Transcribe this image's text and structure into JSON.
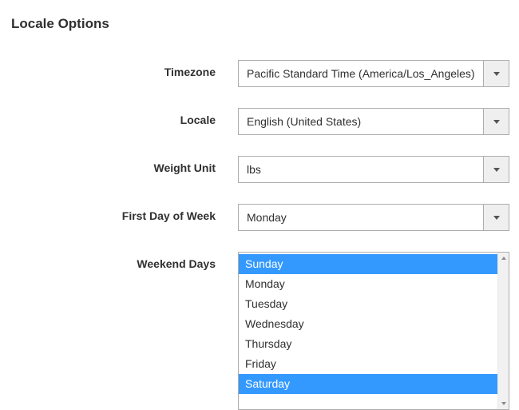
{
  "section": {
    "title": "Locale Options"
  },
  "fields": {
    "timezone": {
      "label": "Timezone",
      "value": "Pacific Standard Time (America/Los_Angeles)"
    },
    "locale": {
      "label": "Locale",
      "value": "English (United States)"
    },
    "weight_unit": {
      "label": "Weight Unit",
      "value": "lbs"
    },
    "first_day": {
      "label": "First Day of Week",
      "value": "Monday"
    },
    "weekend_days": {
      "label": "Weekend Days",
      "options": [
        {
          "label": "Sunday",
          "selected": true
        },
        {
          "label": "Monday",
          "selected": false
        },
        {
          "label": "Tuesday",
          "selected": false
        },
        {
          "label": "Wednesday",
          "selected": false
        },
        {
          "label": "Thursday",
          "selected": false
        },
        {
          "label": "Friday",
          "selected": false
        },
        {
          "label": "Saturday",
          "selected": true
        }
      ]
    }
  }
}
